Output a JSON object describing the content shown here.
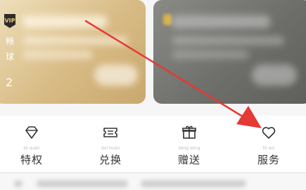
{
  "side": {
    "vip_badge": "VIP",
    "line1": "畅",
    "line2": "球",
    "number": "2"
  },
  "menu": {
    "items": [
      {
        "icon": "diamond-icon",
        "label": "特权",
        "pinyin": "tè quán"
      },
      {
        "icon": "ticket-icon",
        "label": "兑换",
        "pinyin": "duì huàn"
      },
      {
        "icon": "gift-icon",
        "label": "赠送",
        "pinyin": "zèng sòng"
      },
      {
        "icon": "heart-icon",
        "label": "服务",
        "pinyin": "fú wù"
      }
    ]
  },
  "colors": {
    "arrow": "#e53935",
    "gold_card": "#d8bb85",
    "dark_card": "#6e6e6a"
  }
}
